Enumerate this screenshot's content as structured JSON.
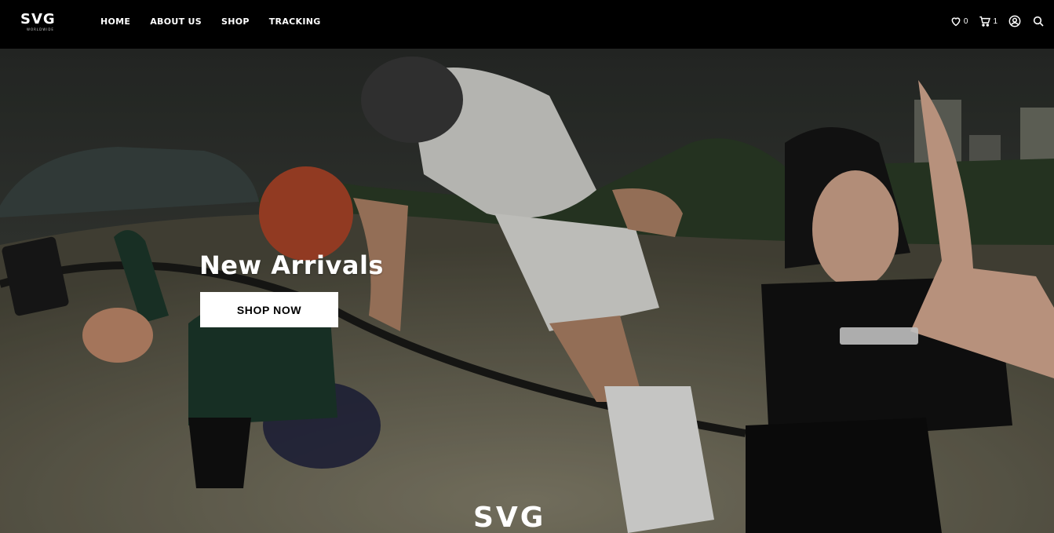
{
  "brand": {
    "logo": "SVG",
    "logo_sub": "WORLDWIDE"
  },
  "nav": {
    "links": [
      "HOME",
      "ABOUT US",
      "SHOP",
      "TRACKING"
    ]
  },
  "icons": {
    "wishlist": {
      "icon": "heart-icon",
      "count": "0"
    },
    "cart": {
      "icon": "cart-icon",
      "count": "1"
    },
    "account": {
      "icon": "user-icon"
    },
    "search": {
      "icon": "search-icon"
    }
  },
  "hero": {
    "title": "New Arrivals",
    "button": "SHOP NOW",
    "watermark_logo": "SVG"
  },
  "colors": {
    "nav_bg": "#000000",
    "button_bg": "#ffffff",
    "button_text": "#000000",
    "text": "#ffffff"
  }
}
